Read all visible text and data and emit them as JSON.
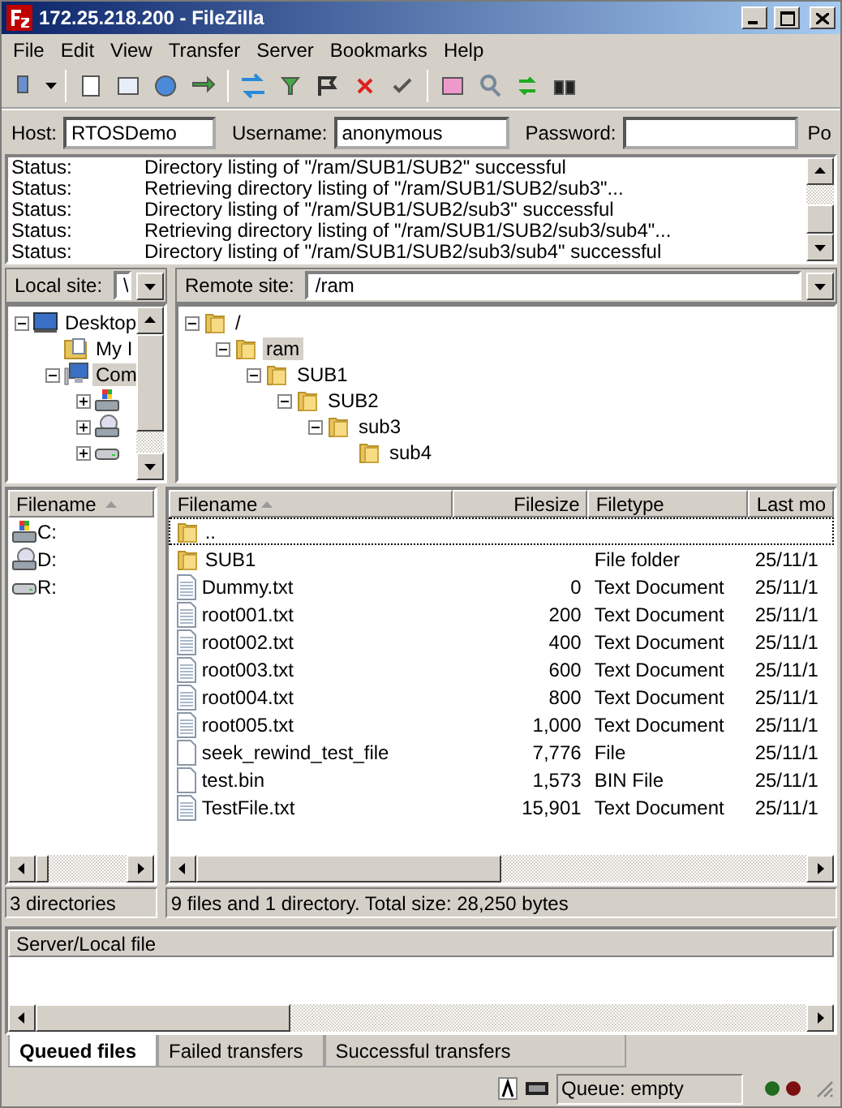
{
  "window": {
    "title": "172.25.218.200 - FileZilla"
  },
  "menu": [
    "File",
    "Edit",
    "View",
    "Transfer",
    "Server",
    "Bookmarks",
    "Help"
  ],
  "quickconnect": {
    "host_label": "Host:",
    "host": "RTOSDemo",
    "username_label": "Username:",
    "username": "anonymous",
    "password_label": "Password:",
    "port_label": "Po"
  },
  "log": [
    {
      "label": "Status:",
      "message": "Directory listing of \"/ram/SUB1/SUB2\" successful"
    },
    {
      "label": "Status:",
      "message": "Retrieving directory listing of \"/ram/SUB1/SUB2/sub3\"..."
    },
    {
      "label": "Status:",
      "message": "Directory listing of \"/ram/SUB1/SUB2/sub3\" successful"
    },
    {
      "label": "Status:",
      "message": "Retrieving directory listing of \"/ram/SUB1/SUB2/sub3/sub4\"..."
    },
    {
      "label": "Status:",
      "message": "Directory listing of \"/ram/SUB1/SUB2/sub3/sub4\" successful"
    }
  ],
  "local_site": {
    "label": "Local site:",
    "path": "\\"
  },
  "remote_site": {
    "label": "Remote site:",
    "path": "/ram"
  },
  "local_tree": [
    {
      "label": "Desktop",
      "kind": "desktop",
      "expanded": true,
      "selected": false,
      "children": [
        {
          "label": "My I",
          "kind": "documents",
          "selected": false
        },
        {
          "label": "Com",
          "kind": "computer",
          "expanded": true,
          "selected": true,
          "children": [
            {
              "kind": "windows-drive",
              "expanded": false
            },
            {
              "kind": "cd-drive",
              "expanded": false
            },
            {
              "kind": "drive",
              "expanded": false
            }
          ]
        }
      ]
    }
  ],
  "remote_tree": [
    {
      "label": "/",
      "kind": "folder",
      "expanded": true,
      "selected": false,
      "children": [
        {
          "label": "ram",
          "kind": "folder",
          "expanded": true,
          "selected": true,
          "children": [
            {
              "label": "SUB1",
              "kind": "folder",
              "expanded": true,
              "selected": false,
              "children": [
                {
                  "label": "SUB2",
                  "kind": "folder",
                  "expanded": true,
                  "selected": false,
                  "children": [
                    {
                      "label": "sub3",
                      "kind": "folder",
                      "expanded": true,
                      "selected": false,
                      "children": [
                        {
                          "label": "sub4",
                          "kind": "folder",
                          "selected": false
                        }
                      ]
                    }
                  ]
                }
              ]
            }
          ]
        }
      ]
    }
  ],
  "local_list": {
    "columns": [
      "Filename"
    ],
    "rows": [
      {
        "name": "C:",
        "kind": "windows-drive"
      },
      {
        "name": "D:",
        "kind": "cd-drive"
      },
      {
        "name": "R:",
        "kind": "drive"
      }
    ],
    "status": "3 directories"
  },
  "remote_list": {
    "columns": [
      "Filename",
      "Filesize",
      "Filetype",
      "Last mo"
    ],
    "rows": [
      {
        "name": "..",
        "kind": "folder",
        "size": "",
        "type": "",
        "modified": "",
        "focused": true
      },
      {
        "name": "SUB1",
        "kind": "folder",
        "size": "",
        "type": "File folder",
        "modified": "25/11/1",
        "focused": false
      },
      {
        "name": "Dummy.txt",
        "kind": "text",
        "size": "0",
        "type": "Text Document",
        "modified": "25/11/1",
        "focused": false
      },
      {
        "name": "root001.txt",
        "kind": "text",
        "size": "200",
        "type": "Text Document",
        "modified": "25/11/1",
        "focused": false
      },
      {
        "name": "root002.txt",
        "kind": "text",
        "size": "400",
        "type": "Text Document",
        "modified": "25/11/1",
        "focused": false
      },
      {
        "name": "root003.txt",
        "kind": "text",
        "size": "600",
        "type": "Text Document",
        "modified": "25/11/1",
        "focused": false
      },
      {
        "name": "root004.txt",
        "kind": "text",
        "size": "800",
        "type": "Text Document",
        "modified": "25/11/1",
        "focused": false
      },
      {
        "name": "root005.txt",
        "kind": "text",
        "size": "1,000",
        "type": "Text Document",
        "modified": "25/11/1",
        "focused": false
      },
      {
        "name": "seek_rewind_test_file",
        "kind": "file",
        "size": "7,776",
        "type": "File",
        "modified": "25/11/1",
        "focused": false
      },
      {
        "name": "test.bin",
        "kind": "file",
        "size": "1,573",
        "type": "BIN File",
        "modified": "25/11/1",
        "focused": false
      },
      {
        "name": "TestFile.txt",
        "kind": "text",
        "size": "15,901",
        "type": "Text Document",
        "modified": "25/11/1",
        "focused": false
      }
    ],
    "status": "9 files and 1 directory. Total size: 28,250 bytes"
  },
  "queue": {
    "columns": [
      "Server/Local file"
    ]
  },
  "queue_tabs": [
    {
      "label": "Queued files",
      "selected": true
    },
    {
      "label": "Failed transfers",
      "selected": false
    },
    {
      "label": "Successful transfers",
      "selected": false
    }
  ],
  "status_bar": {
    "queue": "Queue: empty"
  }
}
